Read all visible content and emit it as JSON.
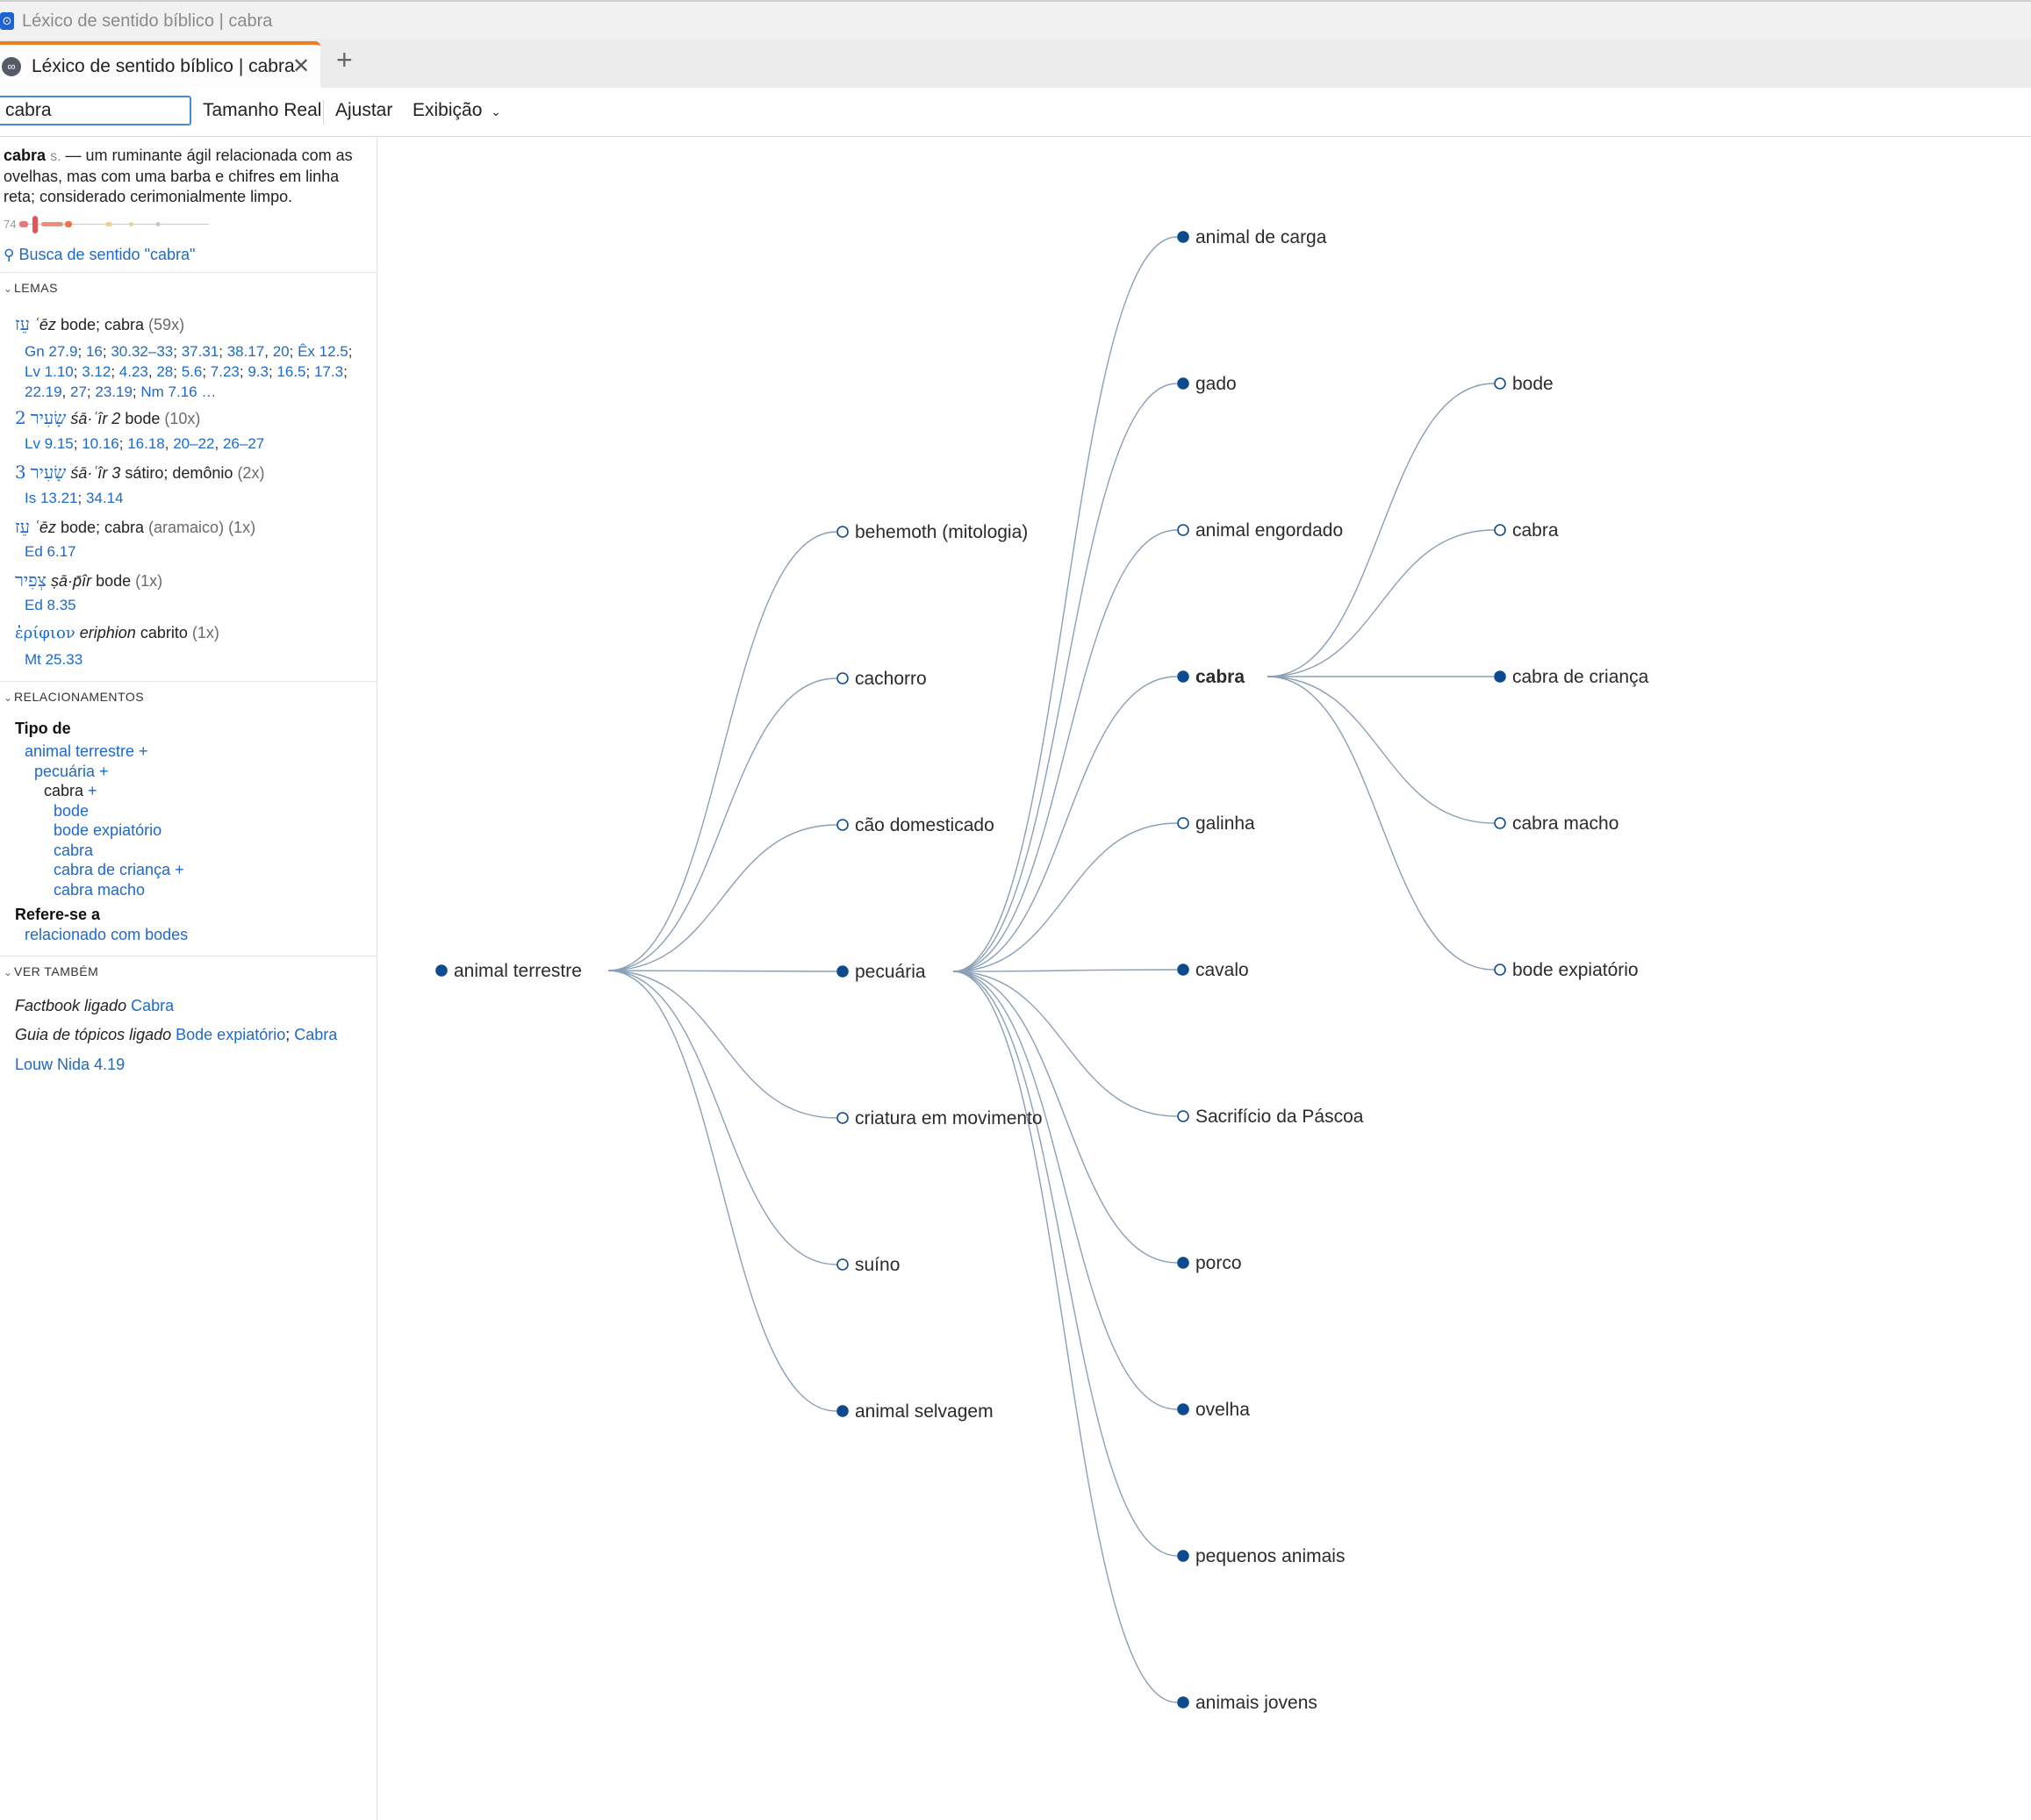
{
  "window": {
    "title": "Léxico de sentido bíblico | cabra"
  },
  "tab": {
    "title": "Léxico de sentido bíblico | cabra",
    "close": "✕",
    "new_tab": "+"
  },
  "toolbar": {
    "search_value": "cabra",
    "actual_size": "Tamanho Real",
    "fit": "Ajustar",
    "view": "Exibição"
  },
  "definition": {
    "term": "cabra",
    "pos": "s.",
    "text": " — um ruminante ágil relacionada com as ovelhas, mas com uma barba e chifres em linha reta; considerado cerimonialmente limpo.",
    "frequency": "74",
    "search_link": "Busca de sentido \"cabra\""
  },
  "lemmas": {
    "header": "LEMAS",
    "items": [
      {
        "num": "",
        "hebrew": "עֵז",
        "translit": "ʿēz",
        "gloss": "bode; cabra",
        "count": "(59x)"
      },
      {
        "num": "2",
        "hebrew": "שָׂעִיר",
        "translit": "śā·ʿîr 2",
        "gloss": "bode",
        "count": "(10x)"
      },
      {
        "num": "3",
        "hebrew": "שָׂעִיר",
        "translit": "śā·ʿîr 3",
        "gloss": "sátiro; demônio",
        "count": "(2x)"
      },
      {
        "num": "",
        "hebrew": "עֵז",
        "translit": "ʿēz",
        "gloss": "bode; cabra",
        "count": "(aramaico) (1x)"
      },
      {
        "num": "",
        "hebrew": "צְפִיר",
        "translit": "ṣā·p̄îr",
        "gloss": "bode",
        "count": "(1x)"
      },
      {
        "num": "",
        "hebrew": "ἐρίφιον",
        "translit": "eriphion",
        "gloss": "cabrito",
        "count": "(1x)"
      }
    ],
    "refs": [
      [
        "Gn 27.9",
        "16",
        "30.32–33",
        "37.31",
        "38.17",
        "20",
        "Êx 12.5",
        "Lv 1.10",
        "3.12",
        "4.23",
        "28",
        "5.6",
        "7.23",
        "9.3",
        "16.5",
        "17.3",
        "22.19",
        "27",
        "23.19",
        "Nm 7.16 …"
      ],
      [
        "Lv 9.15",
        "10.16",
        "16.18",
        "20–22",
        "26–27"
      ],
      [
        "Is 13.21",
        "34.14"
      ],
      [
        "Ed 6.17"
      ],
      [
        "Ed 8.35"
      ],
      [
        "Mt 25.33"
      ]
    ]
  },
  "relationships": {
    "header": "RELACIONAMENTOS",
    "type_of_label": "Tipo de",
    "tree": [
      {
        "label": "animal terrestre +",
        "level": 1,
        "link": true
      },
      {
        "label": "pecuária +",
        "level": 2,
        "link": true
      },
      {
        "label": "cabra",
        "level": 3,
        "link": false,
        "plus": "+"
      },
      {
        "label": "bode",
        "level": 4,
        "link": true
      },
      {
        "label": "bode expiatório",
        "level": 4,
        "link": true
      },
      {
        "label": "cabra",
        "level": 4,
        "link": true
      },
      {
        "label": "cabra de criança +",
        "level": 4,
        "link": true
      },
      {
        "label": "cabra macho",
        "level": 4,
        "link": true
      }
    ],
    "refers_to_label": "Refere-se a",
    "refers_to": "relacionado com bodes"
  },
  "see_also": {
    "header": "VER TAMBÉM",
    "factbook_label": "Factbook ligado",
    "factbook_link": "Cabra",
    "topic_label": "Guia de tópicos ligado",
    "topic_link1": "Bode expiatório",
    "topic_link2": "Cabra",
    "louw_nida": "Louw Nida 4.19"
  },
  "graph": {
    "root": {
      "label": "animal terrestre",
      "filled": true
    },
    "level1": [
      {
        "label": "behemoth (mitologia)",
        "filled": false
      },
      {
        "label": "cachorro",
        "filled": false
      },
      {
        "label": "cão domesticado",
        "filled": false
      },
      {
        "label": "pecuária",
        "filled": true
      },
      {
        "label": "criatura em movimento",
        "filled": false
      },
      {
        "label": "suíno",
        "filled": false
      },
      {
        "label": "animal selvagem",
        "filled": true
      }
    ],
    "level2": [
      {
        "label": "animal de carga",
        "filled": true
      },
      {
        "label": "gado",
        "filled": true
      },
      {
        "label": "animal engordado",
        "filled": false
      },
      {
        "label": "cabra",
        "filled": true,
        "bold": true
      },
      {
        "label": "galinha",
        "filled": false
      },
      {
        "label": "cavalo",
        "filled": true
      },
      {
        "label": "Sacrifício da Páscoa",
        "filled": false
      },
      {
        "label": "porco",
        "filled": true
      },
      {
        "label": "ovelha",
        "filled": true
      },
      {
        "label": "pequenos animais",
        "filled": true
      },
      {
        "label": "animais jovens",
        "filled": true
      }
    ],
    "level3": [
      {
        "label": "bode",
        "filled": false
      },
      {
        "label": "cabra",
        "filled": false
      },
      {
        "label": "cabra de criança",
        "filled": true
      },
      {
        "label": "cabra macho",
        "filled": false
      },
      {
        "label": "bode expiatório",
        "filled": false
      }
    ],
    "colors": {
      "node": "#0d4a8f",
      "edge": "#8aa0b8"
    }
  }
}
